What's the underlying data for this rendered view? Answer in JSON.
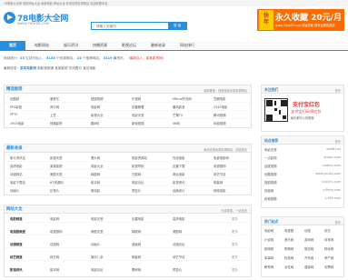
{
  "topbar": {
    "text": "78电影大全网 电影网址大全 最新电影 网址大全 收录优质影视网站 欢迎收藏本站"
  },
  "logo": {
    "name": "78电影大全网",
    "url": "WWW.78DY00.COM"
  },
  "search": {
    "placeholder": "请输入关键词",
    "value": "请输入关键词",
    "button": "搜 索"
  },
  "ad_top": {
    "badge": "快\n年",
    "headline": "永久收藏 20元/月",
    "sub": "www.78dy00.com 网址导航 推荐优质资源站"
  },
  "nav": {
    "items": [
      "首页",
      "电影网站",
      "娱乐资讯",
      "快播资源",
      "影视论坛",
      "最新收录",
      "网站排行"
    ]
  },
  "stats": {
    "row1": [
      "网站统计：",
      "23",
      " 位站长加入， ",
      "5155",
      " 个优秀网站， ",
      "22",
      " 个推荐网站， ",
      "3119",
      " 篇资讯。",
      "（最新加入：",
      "某某影视网",
      "）"
    ],
    "row2": [
      "最新收录：",
      "某某电影网",
      "  新影视频道",
      "  某某影院",
      "  在线看片",
      "  某站电影"
    ]
  },
  "sections": [
    {
      "id": "tuijian",
      "title": "精选推荐",
      "note": "最新推荐，快速找到优质影视网站",
      "rows": [
        [
          "优酷网",
          "爱奇艺",
          "搜狐视频",
          "乐视网",
          "Mtime时光网",
          "豆瓣电影"
        ],
        [
          "PPS影音",
          "风行网",
          "电影网",
          "迅雷看看",
          "暴风影音",
          "2345电影"
        ],
        [
          "PPTV",
          "土豆",
          "影视大全",
          "电影天堂",
          "芒果TV",
          "腾讯视频"
        ],
        [
          "1905电影",
          "快播影院",
          "酷6网",
          "新浪视频",
          "56网",
          "凤凰视频"
        ]
      ]
    },
    {
      "id": "zuixin",
      "title": "最新收录",
      "note": "每日收录优质影视网站，欢迎提交",
      "rows": [
        [
          "新片资讯站",
          "影视天堂",
          "看片网",
          "电影资源站",
          "在线电影",
          "免费电影网"
        ],
        [
          "高清电影",
          "某某影院",
          "电影大全",
          "影视导航",
          "迅雷下载",
          "电视剧网"
        ],
        [
          "动漫网站",
          "美剧天堂",
          "韩剧网",
          "日剧网",
          "港台电影",
          "综艺节目"
        ],
        [
          "电影下载站",
          "BT资源网",
          "影评网",
          "电影论坛",
          "影视资讯",
          "明星网"
        ],
        [
          "动画片",
          "纪录片",
          "微电影",
          "预告片",
          "经典老片",
          "网络电影"
        ]
      ]
    },
    {
      "id": "daquan",
      "title": "网站大全",
      "note": "分类导航，一站找全",
      "rows": [
        [
          "电影频道",
          "电影网",
          "电影天堂",
          "迅雷电影",
          "高清电影",
          "更多"
        ],
        [
          "电视剧频道",
          "电视剧网",
          "美剧天堂",
          "韩剧网",
          "港剧网",
          "更多"
        ],
        [
          "动漫频道",
          "动漫网",
          "动画片",
          "漫画网",
          "动漫论坛",
          "更多"
        ],
        [
          "综艺频道",
          "综艺网",
          "娱乐八卦",
          "明星网",
          "综艺节目",
          "更多"
        ],
        [
          "影视资讯",
          "影评网",
          "电影论坛",
          "票房网",
          "预告片",
          "更多"
        ]
      ]
    }
  ],
  "sidebar": {
    "about": {
      "title": "关注我们",
      "more": "更多",
      "qr_title": "支付宝红包",
      "qr_sub": "支付宝扫码领红包",
      "qr_sub2": "每天都可以领取哦"
    },
    "collect": {
      "title": "站点推荐",
      "more": "更多",
      "rows": [
        [
          "电影天堂",
          "dytt8.net"
        ],
        [
          "一点影视",
          "yidian.com"
        ],
        [
          "百度视频",
          "v.baidu.com"
        ],
        [
          "优酷视频",
          "www.youku.com"
        ],
        [
          "搜狐视频",
          "tv.sohu.com"
        ],
        [
          "凤凰网",
          "v.ifeng.com"
        ],
        [
          "网易视频",
          "v.163.com"
        ]
      ]
    },
    "hot": {
      "title": "热门站点",
      "more": "更多",
      "rows": [
        [
          "电影网",
          "电视剧",
          "动漫",
          "综艺"
        ],
        [
          "小说网",
          "音乐网",
          "游戏网",
          "体育网"
        ],
        [
          "新闻网",
          "购物网",
          "旅游网",
          "财经网"
        ],
        [
          "军事网",
          "科技网",
          "汽车网",
          "房产网"
        ],
        [
          "教育网",
          "女性网",
          "健康网",
          "彩票网"
        ]
      ]
    }
  },
  "colors": {
    "accent": "#2a8ede",
    "ad": "#ff6a00",
    "link_red": "#e03a3a"
  }
}
